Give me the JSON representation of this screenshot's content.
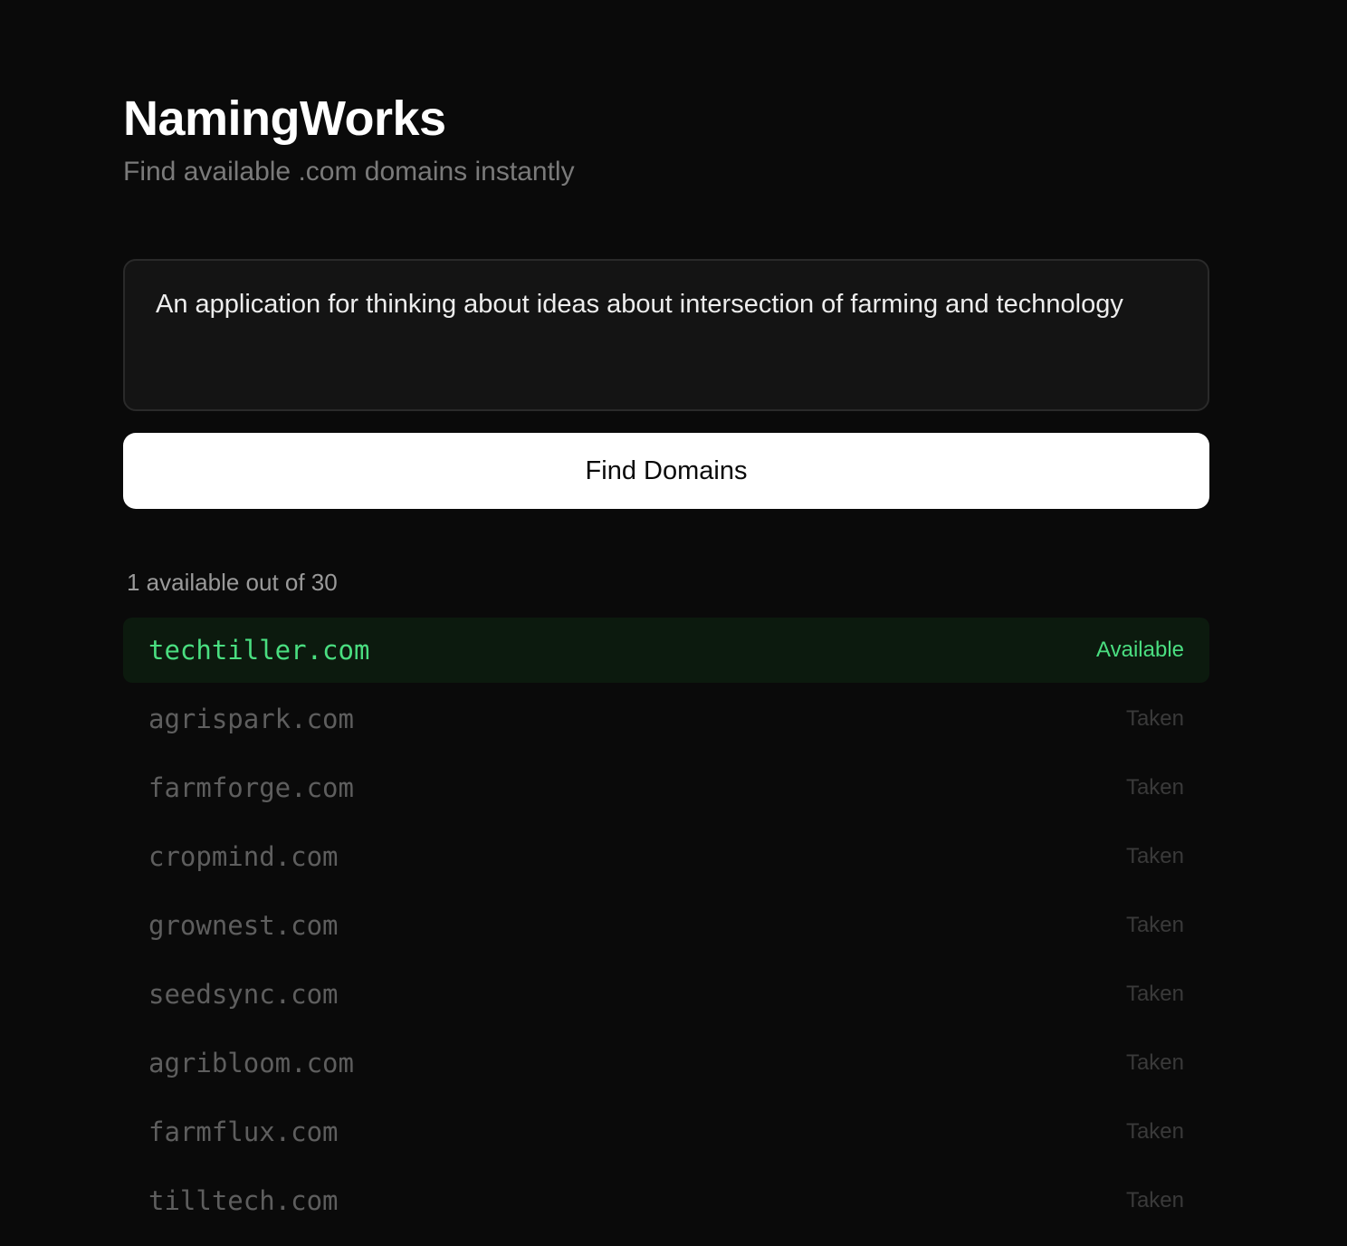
{
  "app": {
    "title": "NamingWorks",
    "subtitle": "Find available .com domains instantly"
  },
  "prompt": {
    "value": "An application for thinking about ideas about intersection of farming and technology"
  },
  "actions": {
    "find_label": "Find Domains"
  },
  "results": {
    "summary": "1 available out of 30",
    "items": [
      {
        "domain": "techtiller.com",
        "status": "Available"
      },
      {
        "domain": "agrispark.com",
        "status": "Taken"
      },
      {
        "domain": "farmforge.com",
        "status": "Taken"
      },
      {
        "domain": "cropmind.com",
        "status": "Taken"
      },
      {
        "domain": "grownest.com",
        "status": "Taken"
      },
      {
        "domain": "seedsync.com",
        "status": "Taken"
      },
      {
        "domain": "agribloom.com",
        "status": "Taken"
      },
      {
        "domain": "farmflux.com",
        "status": "Taken"
      },
      {
        "domain": "tilltech.com",
        "status": "Taken"
      }
    ]
  },
  "colors": {
    "background": "#0a0a0a",
    "available": "#4ade80",
    "available_row_bg": "#0c1a0e",
    "taken_text": "#5e5e5e"
  }
}
